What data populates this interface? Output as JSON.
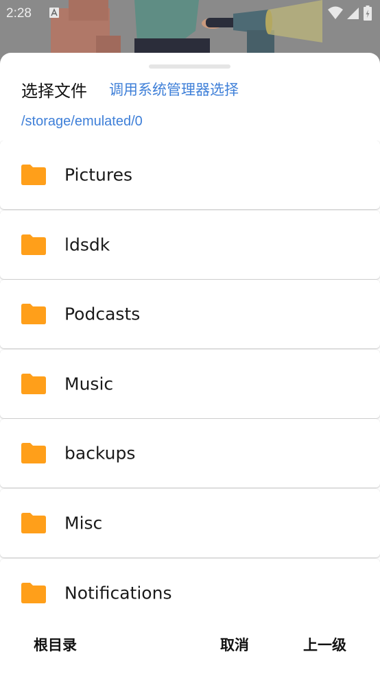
{
  "status_bar": {
    "time": "2:28"
  },
  "sheet": {
    "title": "选择文件",
    "system_picker_label": "调用系统管理器选择",
    "current_path": "/storage/emulated/0"
  },
  "files": [
    {
      "name": "Pictures",
      "icon": "folder-icon"
    },
    {
      "name": "ldsdk",
      "icon": "folder-icon"
    },
    {
      "name": "Podcasts",
      "icon": "folder-icon"
    },
    {
      "name": "Music",
      "icon": "folder-icon"
    },
    {
      "name": "backups",
      "icon": "folder-icon"
    },
    {
      "name": "Misc",
      "icon": "folder-icon"
    },
    {
      "name": "Notifications",
      "icon": "folder-icon"
    }
  ],
  "footer": {
    "root_label": "根目录",
    "cancel_label": "取消",
    "up_label": "上一级"
  },
  "colors": {
    "accent": "#3e7fd8",
    "folder": "#ff9f1a",
    "sheet_bg": "#ffffff",
    "scrim": "#7f7f7f"
  }
}
